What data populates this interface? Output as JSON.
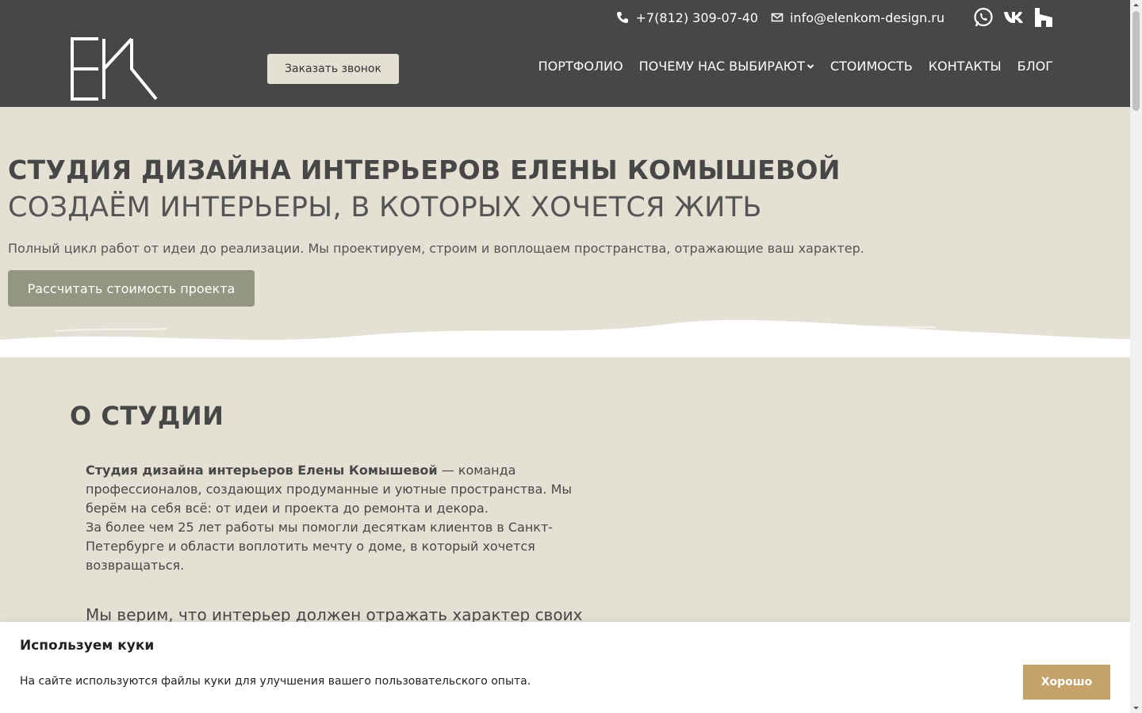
{
  "header": {
    "logo_alt": "EK",
    "phone": "+7(812) 309-07-40",
    "email": "info@elenkom-design.ru",
    "callback_label": "Заказать звонок",
    "social": [
      "whatsapp-icon",
      "vk-icon",
      "houzz-icon"
    ],
    "nav": [
      {
        "label": "ПОРТФОЛИО"
      },
      {
        "label": "ПОЧЕМУ НАС ВЫБИРАЮТ",
        "dropdown": true
      },
      {
        "label": "СТОИМОСТЬ"
      },
      {
        "label": "КОНТАКТЫ"
      },
      {
        "label": "БЛОГ"
      }
    ]
  },
  "hero": {
    "title": "СТУДИЯ ДИЗАЙНА ИНТЕРЬЕРОВ ЕЛЕНЫ КОМЫШЕВОЙ",
    "subtitle": "СОЗДАЁМ ИНТЕРЬЕРЫ, В КОТОРЫХ ХОЧЕТСЯ ЖИТЬ",
    "lead": "Полный цикл работ от идеи до реализации. Мы проектируем, строим и воплощаем пространства, отражающие ваш характер.",
    "cta_label": "Рассчитать стоимость проекта"
  },
  "about": {
    "title": "О СТУДИИ",
    "strong": "Студия дизайна интерьеров Елены Комышевой",
    "p1_rest": " — команда профессионалов, создающих продуманные и уютные пространства. Мы берём на себя всё: от идеи и проекта до ремонта и декора.",
    "p2": "За более чем 25 лет работы мы помогли десяткам клиентов в Санкт-Петербурге и области воплотить мечту о доме, в который хочется возвращаться.",
    "quote": "Мы верим, что интерьер должен отражать характер своих"
  },
  "cookie": {
    "title": "Используем куки",
    "text": "На сайте используются файлы куки для улучшения вашего пользовательского опыта.",
    "ok_label": "Хорошо"
  },
  "colors": {
    "header_bg": "#474747",
    "page_bg": "#e4e0d4",
    "cta_bg": "#939680",
    "cookie_btn": "#c4a269"
  }
}
